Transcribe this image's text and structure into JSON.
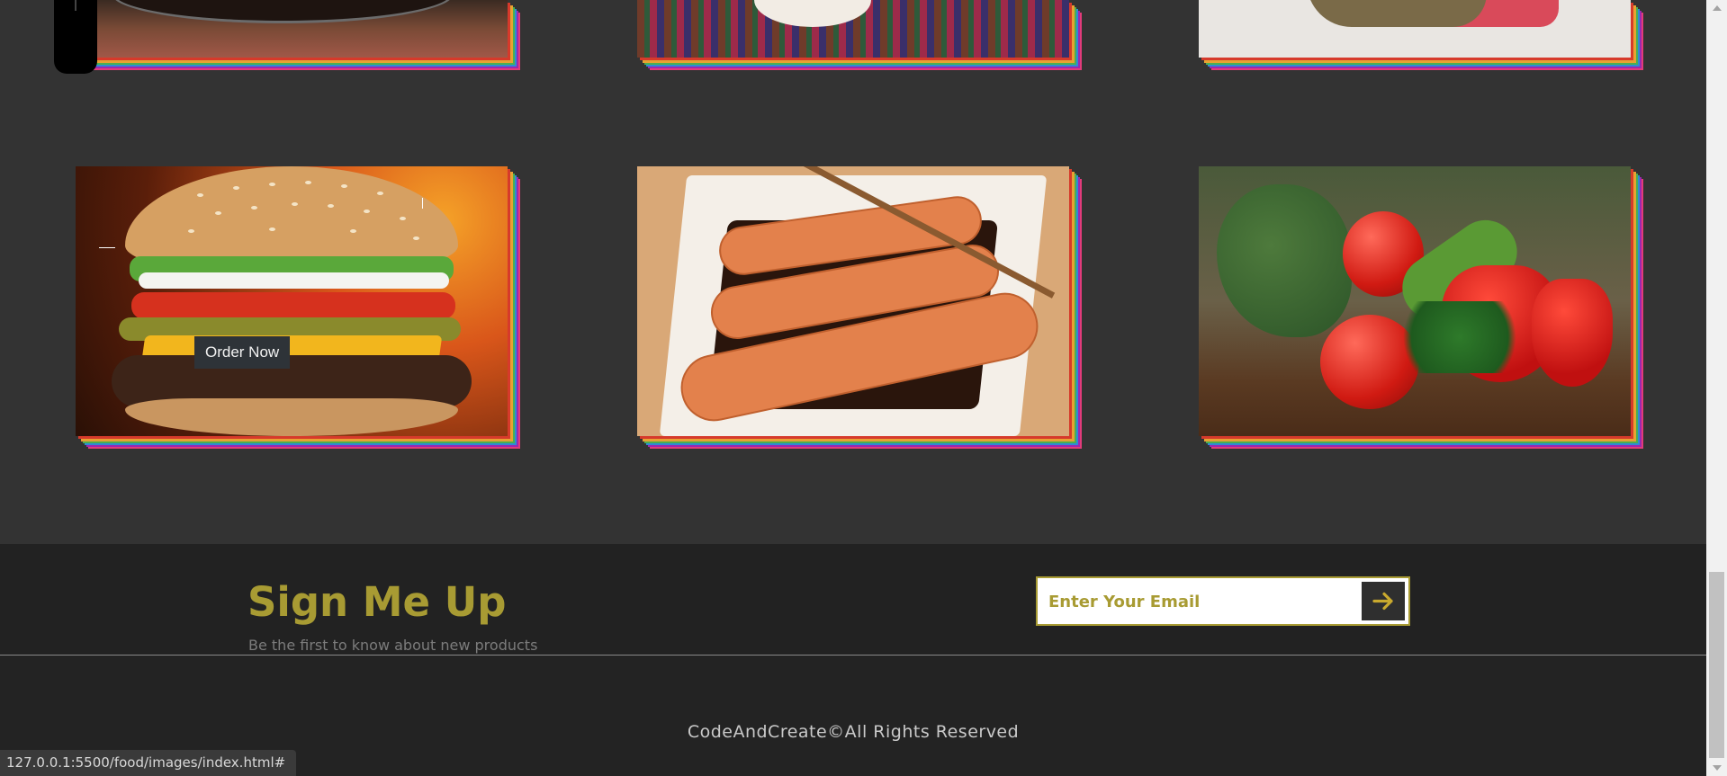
{
  "gallery": {
    "order_button_label": "Order Now"
  },
  "signup": {
    "title": "Sign Me Up",
    "subtitle": "Be the first to know about new products",
    "email_placeholder": "Enter Your Email",
    "submit_icon": "arrow-right-icon"
  },
  "footer": {
    "copyright": "CodeAndCreate©All Rights Reserved"
  },
  "status_bar": {
    "url": "127.0.0.1:5500/food/images/index.html#"
  },
  "colors": {
    "page_background": "#333333",
    "section_background": "#222222",
    "accent": "#a89b33"
  }
}
